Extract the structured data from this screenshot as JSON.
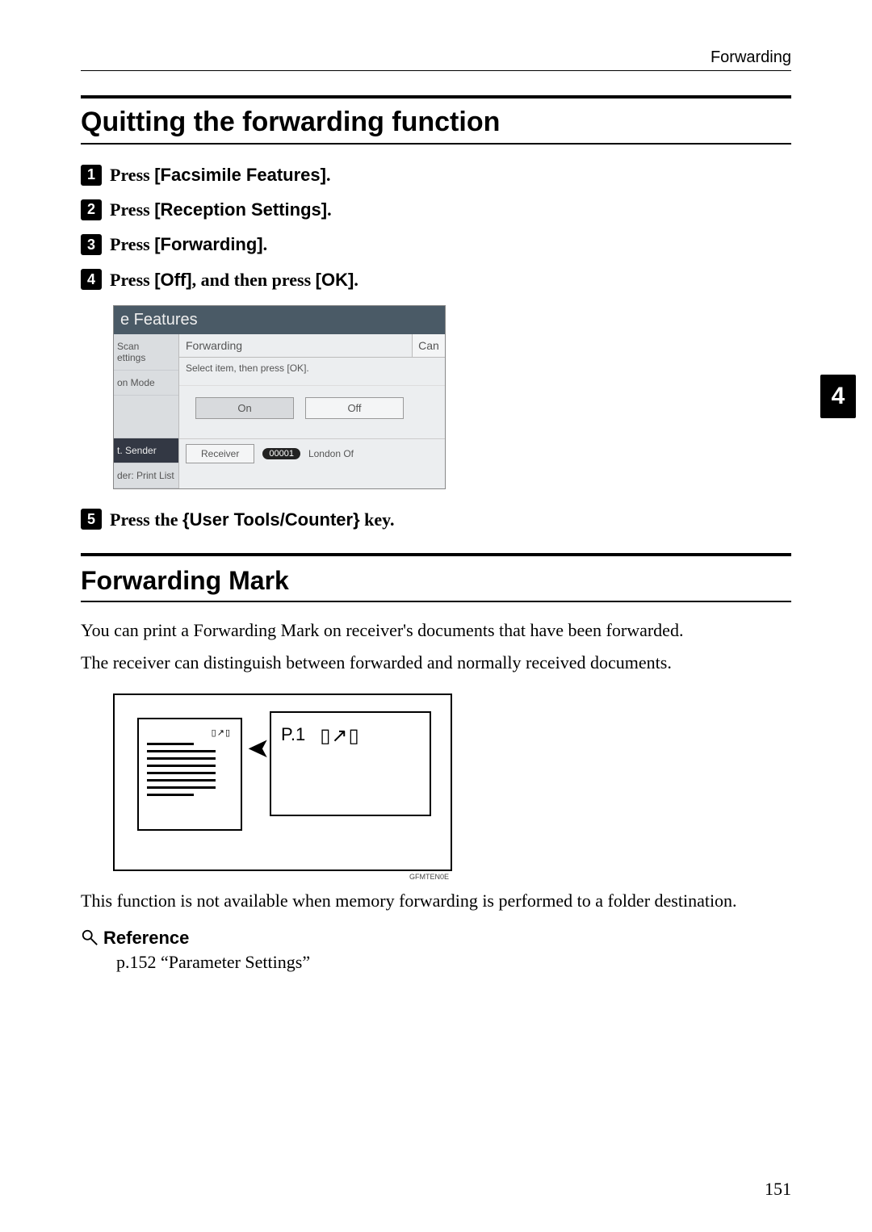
{
  "header": {
    "running_head": "Forwarding"
  },
  "section1": {
    "title": "Quitting the forwarding function",
    "steps": {
      "s1_pre": "Press ",
      "s1_key": "[Facsimile Features]",
      "s1_post": ".",
      "s2_pre": "Press ",
      "s2_key": "[Reception Settings]",
      "s2_post": ".",
      "s3_pre": "Press ",
      "s3_key": "[Forwarding]",
      "s3_post": ".",
      "s4_pre": "Press ",
      "s4_key1": "[Off]",
      "s4_mid": ", and then press ",
      "s4_key2": "[OK]",
      "s4_post": ".",
      "s5_pre": "Press the ",
      "s5_lb": "{",
      "s5_key": "User Tools/Counter",
      "s5_rb": "}",
      "s5_post": " key."
    }
  },
  "screenshot": {
    "titlebar": "e Features",
    "left": {
      "tab1a": "Scan",
      "tab1b": "ettings",
      "tab2": "on Mode",
      "tab3": "t. Sender",
      "tab4": "der: Print List"
    },
    "panel_title": "Forwarding",
    "cancel": "Can",
    "desc": "Select item, then press [OK].",
    "btn_on": "On",
    "btn_off": "Off",
    "receiver_btn": "Receiver",
    "receiver_tag": "00001",
    "receiver_name": "London Of"
  },
  "section2": {
    "title": "Forwarding Mark",
    "para1": "You can print a Forwarding Mark on receiver's documents that have been forwarded.",
    "para2": "The receiver can distinguish between forwarded and normally received documents.",
    "diagram_page": "P.1",
    "diagram_code": "GFMTEN0E",
    "para3": "This function is not available when memory forwarding is performed to a folder destination.",
    "ref_head": "Reference",
    "ref_body": "p.152 “Parameter Settings”"
  },
  "side_tab": "4",
  "page_number": "151"
}
